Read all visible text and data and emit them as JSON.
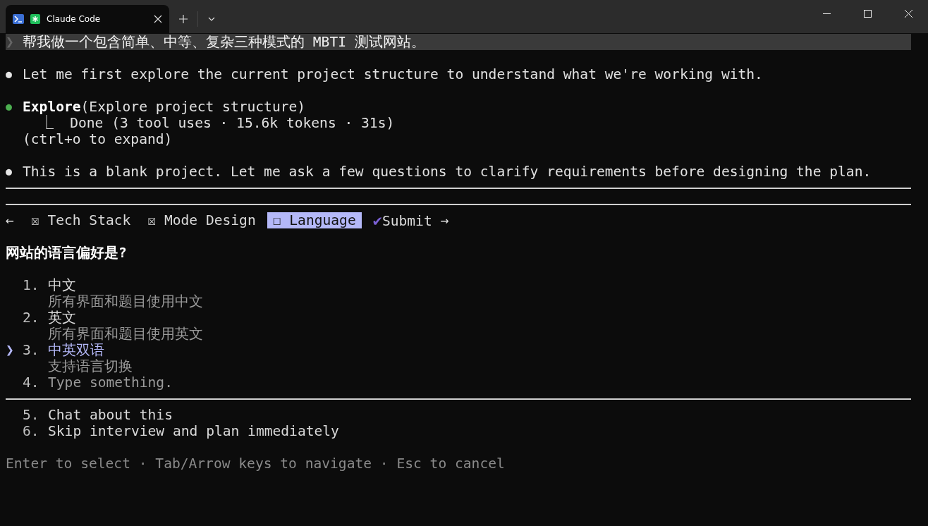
{
  "window": {
    "tabs": [
      {
        "title": "Claude Code",
        "selected": true
      }
    ]
  },
  "prompt": {
    "marker": "❯",
    "text": "帮我做一个包含简单、中等、复杂三种模式的 MBTI 测试网站。"
  },
  "messages": [
    {
      "bullet": "●",
      "color": "#e6e6e6",
      "lines": [
        "Let me first explore the current project structure to understand what we're working with."
      ]
    },
    {
      "bullet": "●",
      "color": "#4caf50",
      "tool": "Explore",
      "args": "(Explore project structure)",
      "lines": [
        "  ⎿  Done (3 tool uses · 15.6k tokens · 31s)",
        "(ctrl+o to expand)"
      ]
    },
    {
      "bullet": "●",
      "color": "#e6e6e6",
      "lines": [
        "This is a blank project. Let me ask a few questions to clarify requirements before designing the plan."
      ]
    }
  ],
  "question_tabs": {
    "prev": "←",
    "next": "→",
    "tabs": [
      {
        "mark": "☒",
        "label": "Tech Stack",
        "kind": "step",
        "selected": false
      },
      {
        "mark": "☒",
        "label": "Mode Design",
        "kind": "step",
        "selected": false
      },
      {
        "mark": "☐",
        "label": "Language",
        "kind": "step",
        "selected": true
      },
      {
        "mark": "✔",
        "label": "Submit",
        "kind": "submit",
        "selected": false
      }
    ]
  },
  "question": "网站的语言偏好是?",
  "options": [
    {
      "number": "1.",
      "label": "中文",
      "description": "所有界面和题目使用中文",
      "kind": "choice",
      "selected": false
    },
    {
      "number": "2.",
      "label": "英文",
      "description": "所有界面和题目使用英文",
      "kind": "choice",
      "selected": false
    },
    {
      "number": "3.",
      "label": "中英双语",
      "description": "支持语言切换",
      "kind": "choice",
      "selected": true
    },
    {
      "number": "4.",
      "label": "Type something.",
      "kind": "input",
      "selected": false
    }
  ],
  "pointer": "❯",
  "extra_options": [
    {
      "number": "5.",
      "label": "Chat about this"
    },
    {
      "number": "6.",
      "label": "Skip interview and plan immediately"
    }
  ],
  "footer": "Enter to select · Tab/Arrow keys to navigate · Esc to cancel"
}
